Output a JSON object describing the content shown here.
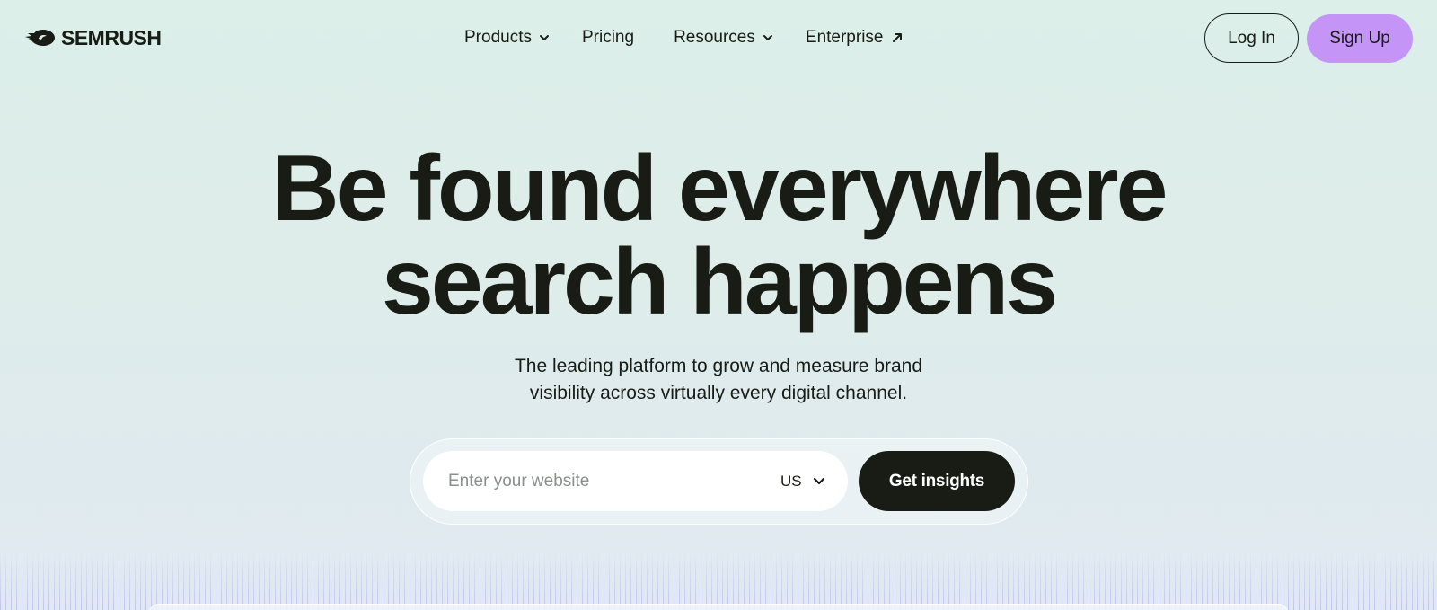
{
  "brand": {
    "name": "SEMRUSH",
    "logo_icon": "semrush-fireball-icon"
  },
  "nav": {
    "items": [
      {
        "label": "Products",
        "icon": "chevron-down-icon"
      },
      {
        "label": "Pricing"
      },
      {
        "label": "Resources",
        "icon": "chevron-down-icon"
      },
      {
        "label": "Enterprise",
        "icon": "arrow-up-right-icon"
      }
    ],
    "login_label": "Log In",
    "signup_label": "Sign Up"
  },
  "hero": {
    "title_line1": "Be found everywhere",
    "title_line2": "search happens",
    "subtitle_line1": "The leading platform to grow and measure brand",
    "subtitle_line2": "visibility across virtually every digital channel."
  },
  "search": {
    "placeholder": "Enter your website",
    "value": "",
    "country": "US",
    "button_label": "Get insights"
  },
  "colors": {
    "text": "#181c15",
    "signup_bg": "#c495f7",
    "button_dark": "#181c15",
    "bg_top": "#dcefe9",
    "bg_bottom": "#e0e9f1"
  }
}
